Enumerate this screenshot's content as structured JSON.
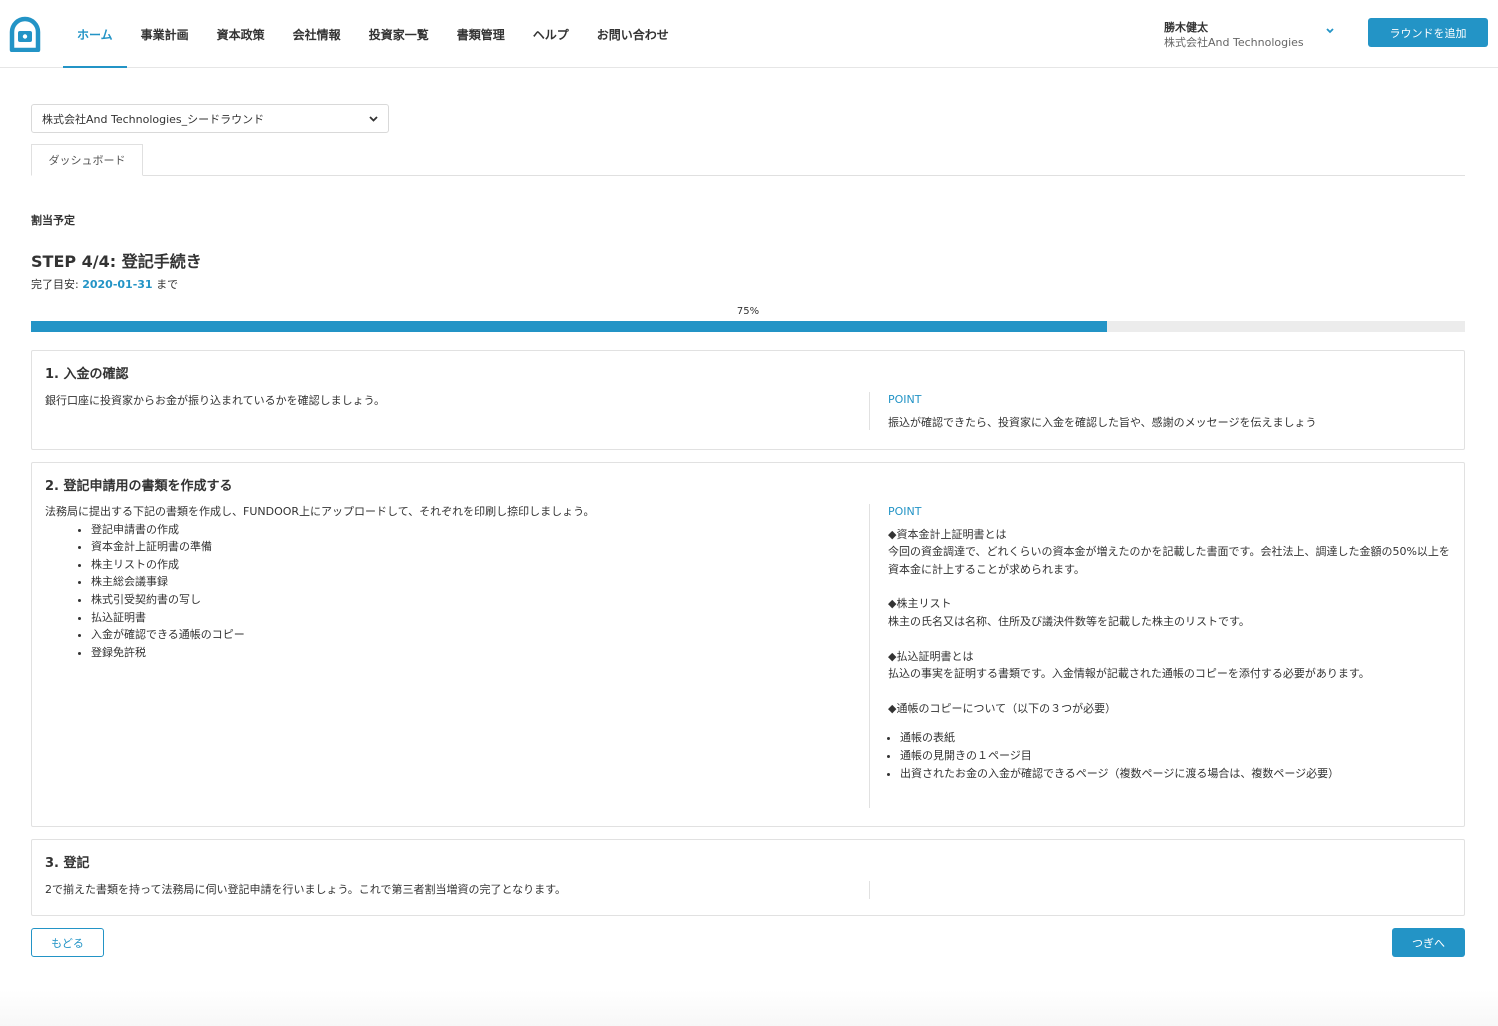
{
  "header": {
    "nav": [
      "ホーム",
      "事業計画",
      "資本政策",
      "会社情報",
      "投資家一覧",
      "書類管理",
      "ヘルプ",
      "お問い合わせ"
    ],
    "active_nav": "ホーム",
    "user_name": "勝木健太",
    "user_company": "株式会社And Technologies",
    "add_round_label": "ラウンドを追加"
  },
  "round_select": {
    "value": "株式会社And Technologies_シードラウンド"
  },
  "tabs": [
    "ダッシュボード"
  ],
  "section_label": "割当予定",
  "step": {
    "title": "STEP 4/4: 登記手続き",
    "due_prefix": "完了目安: ",
    "due_date": "2020-01-31",
    "due_suffix": " まで",
    "progress_label": "75%",
    "progress": 0.75
  },
  "cards": [
    {
      "title": "1. 入金の確認",
      "body": "銀行口座に投資家からお金が振り込まれているかを確認しましょう。",
      "point_label": "POINT",
      "point_text": "振込が確認できたら、投資家に入金を確認した旨や、感謝のメッセージを伝えましょう"
    },
    {
      "title": "2. 登記申請用の書類を作成する",
      "body": "法務局に提出する下記の書類を作成し、FUNDOOR上にアップロードして、それぞれを印刷し捺印しましょう。",
      "items": [
        "登記申請書の作成",
        "資本金計上証明書の準備",
        "株主リストの作成",
        "株主総会議事録",
        "株式引受契約書の写し",
        "払込証明書",
        "入金が確認できる通帳のコピー",
        "登録免許税"
      ],
      "point_label": "POINT",
      "point_blocks": [
        {
          "heading": "◆資本金計上証明書とは",
          "text": "今回の資金調達で、どれくらいの資本金が増えたのかを記載した書面です。会社法上、調達した金額の50%以上を資本金に計上することが求められます。"
        },
        {
          "heading": "◆株主リスト",
          "text": "株主の氏名又は名称、住所及び議決件数等を記載した株主のリストです。"
        },
        {
          "heading": "◆払込証明書とは",
          "text": "払込の事実を証明する書類です。入金情報が記載された通帳のコピーを添付する必要があります。"
        },
        {
          "heading": "◆通帳のコピーについて（以下の３つが必要）",
          "text": ""
        }
      ],
      "point_items": [
        "通帳の表紙",
        "通帳の見開きの１ページ目",
        "出資されたお金の入金が確認できるページ（複数ページに渡る場合は、複数ページ必要）"
      ]
    },
    {
      "title": "3. 登記",
      "body": "2で揃えた書類を持って法務局に伺い登記申請を行いましょう。これで第三者割当増資の完了となります。"
    }
  ],
  "buttons": {
    "back": "もどる",
    "next": "つぎへ"
  },
  "colors": {
    "accent": "#2394c6",
    "track": "#ececec"
  }
}
